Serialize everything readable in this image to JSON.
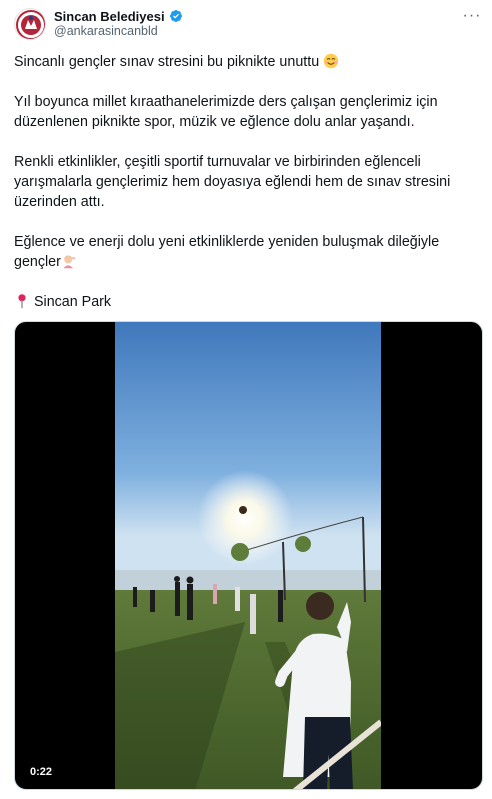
{
  "post": {
    "author": {
      "display_name": "Sincan Belediyesi",
      "handle": "@ankarasincanbld",
      "verified": true,
      "avatar_icon": "sincan-logo-icon"
    },
    "more_icon": "more-options-icon",
    "text": {
      "line1": "Sincanlı gençler sınav stresini bu piknikte unuttu",
      "line2a": "Yıl boyunca millet kıraathanelerimizde ders çalışan gençlerimiz için",
      "line2b": "düzenlenen piknikte spor, müzik ve eğlence dolu anlar yaşandı.",
      "line3a": "Renkli etkinlikler, çeşitli sportif turnuvalar ve birbirinden eğlenceli",
      "line3b": "yarışmalarla gençlerimiz hem doyasıya eğlendi hem de sınav stresini",
      "line3c": "üzerinden attı.",
      "line4a": "Eğlence ve enerji dolu yeni etkinliklerde yeniden buluşmak dileğiyle",
      "line4b": "gençler",
      "location": "Sincan Park"
    },
    "media": {
      "type": "video",
      "duration": "0:22"
    }
  },
  "colors": {
    "text": "#0f1419",
    "secondary": "#536471",
    "verified": "#1d9bf0",
    "pin": "#e0245e"
  }
}
